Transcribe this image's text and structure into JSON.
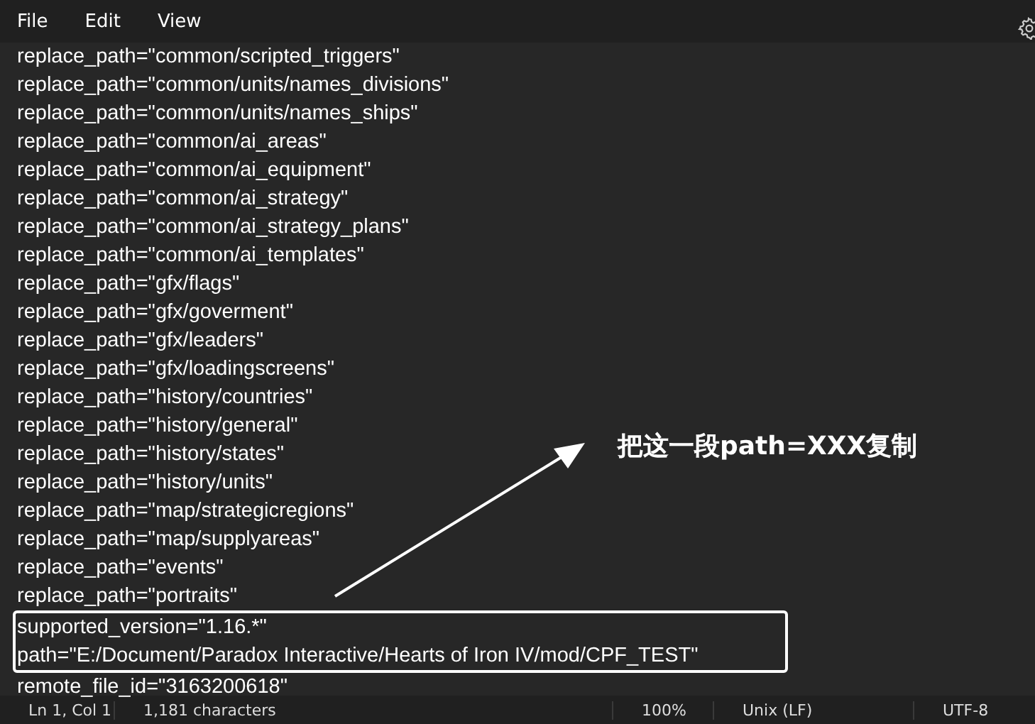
{
  "menu": [
    "File",
    "Edit",
    "View"
  ],
  "lines": [
    {
      "text": "replace_path=\"common/scripted_triggers\"",
      "boxed": false
    },
    {
      "text": "replace_path=\"common/units/names_divisions\"",
      "boxed": false
    },
    {
      "text": "replace_path=\"common/units/names_ships\"",
      "boxed": false
    },
    {
      "text": "replace_path=\"common/ai_areas\"",
      "boxed": false
    },
    {
      "text": "replace_path=\"common/ai_equipment\"",
      "boxed": false
    },
    {
      "text": "replace_path=\"common/ai_strategy\"",
      "boxed": false
    },
    {
      "text": "replace_path=\"common/ai_strategy_plans\"",
      "boxed": false
    },
    {
      "text": "replace_path=\"common/ai_templates\"",
      "boxed": false
    },
    {
      "text": "replace_path=\"gfx/flags\"",
      "boxed": false
    },
    {
      "text": "replace_path=\"gfx/goverment\"",
      "boxed": false
    },
    {
      "text": "replace_path=\"gfx/leaders\"",
      "boxed": false
    },
    {
      "text": "replace_path=\"gfx/loadingscreens\"",
      "boxed": false
    },
    {
      "text": "replace_path=\"history/countries\"",
      "boxed": false
    },
    {
      "text": "replace_path=\"history/general\"",
      "boxed": false
    },
    {
      "text": "replace_path=\"history/states\"",
      "boxed": false
    },
    {
      "text": "replace_path=\"history/units\"",
      "boxed": false
    },
    {
      "text": "replace_path=\"map/strategicregions\"",
      "boxed": false
    },
    {
      "text": "replace_path=\"map/supplyareas\"",
      "boxed": false
    },
    {
      "text": "replace_path=\"events\"",
      "boxed": false
    },
    {
      "text": "replace_path=\"portraits\"",
      "boxed": false
    },
    {
      "text": "supported_version=\"1.16.*\"",
      "boxed": true
    },
    {
      "text": "path=\"E:/Document/Paradox Interactive/Hearts of Iron IV/mod/CPF_TEST\"",
      "boxed": true
    },
    {
      "text": "remote_file_id=\"3163200618\"",
      "boxed": false
    }
  ],
  "annotation": {
    "text": "把这一段path=XXX复制"
  },
  "status_bar": [
    "Ln 1, Col 1",
    "1,181 characters",
    "100%",
    "Unix (LF)",
    "UTF-8"
  ]
}
